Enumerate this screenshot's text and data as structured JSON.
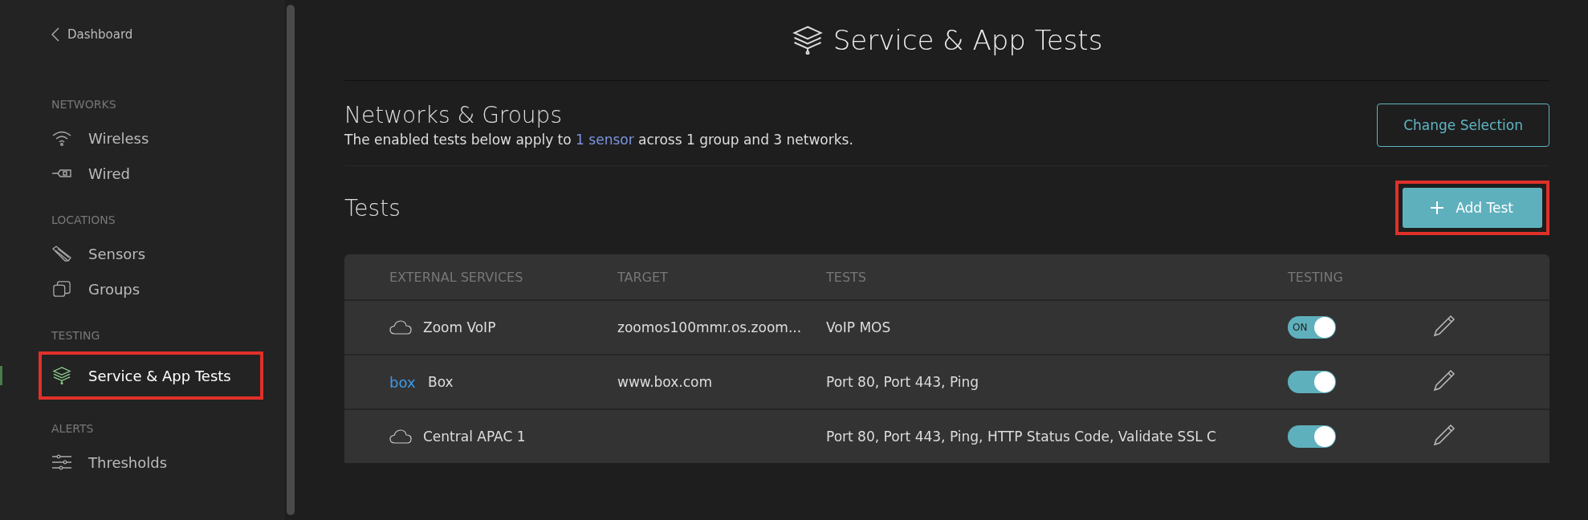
{
  "sidebar": {
    "back_link": "Dashboard",
    "sections": [
      {
        "heading": "NETWORKS",
        "items": [
          {
            "label": "Wireless",
            "kind": "wifi",
            "selected": false
          },
          {
            "label": "Wired",
            "kind": "plug",
            "selected": false
          }
        ]
      },
      {
        "heading": "LOCATIONS",
        "items": [
          {
            "label": "Sensors",
            "kind": "sensor",
            "selected": false
          },
          {
            "label": "Groups",
            "kind": "groups",
            "selected": false
          }
        ]
      },
      {
        "heading": "TESTING",
        "items": [
          {
            "label": "Service & App Tests",
            "kind": "layers",
            "selected": true,
            "highlighted": true
          }
        ]
      },
      {
        "heading": "ALERTS",
        "items": [
          {
            "label": "Thresholds",
            "kind": "sliders",
            "selected": false
          }
        ]
      }
    ]
  },
  "page_title": "Service & App Tests",
  "networks_groups": {
    "title": "Networks & Groups",
    "description_before": "The enabled tests below apply to ",
    "link": "1 sensor",
    "description_after": " across 1 group and 3 networks.",
    "button": "Change Selection"
  },
  "tests": {
    "title": "Tests",
    "add_button": {
      "label": "Add Test",
      "highlighted": true
    },
    "columns": [
      "EXTERNAL SERVICES",
      "TARGET",
      "TESTS",
      "TESTING"
    ],
    "rows": [
      {
        "kind": "cloud",
        "name": "Zoom VoIP",
        "target": "zoomos100mmr.os.zoom...",
        "tests": "VoIP MOS",
        "on": true,
        "toggle_label": "ON"
      },
      {
        "kind": "logo",
        "logo_text": "box",
        "name": "Box",
        "target": "www.box.com",
        "tests": "Port 80, Port 443, Ping",
        "on": true
      },
      {
        "kind": "cloud",
        "name": "Central APAC 1",
        "tests": "Port 80, Port 443, Ping, HTTP Status Code, Validate SSL C",
        "on": true
      }
    ]
  }
}
